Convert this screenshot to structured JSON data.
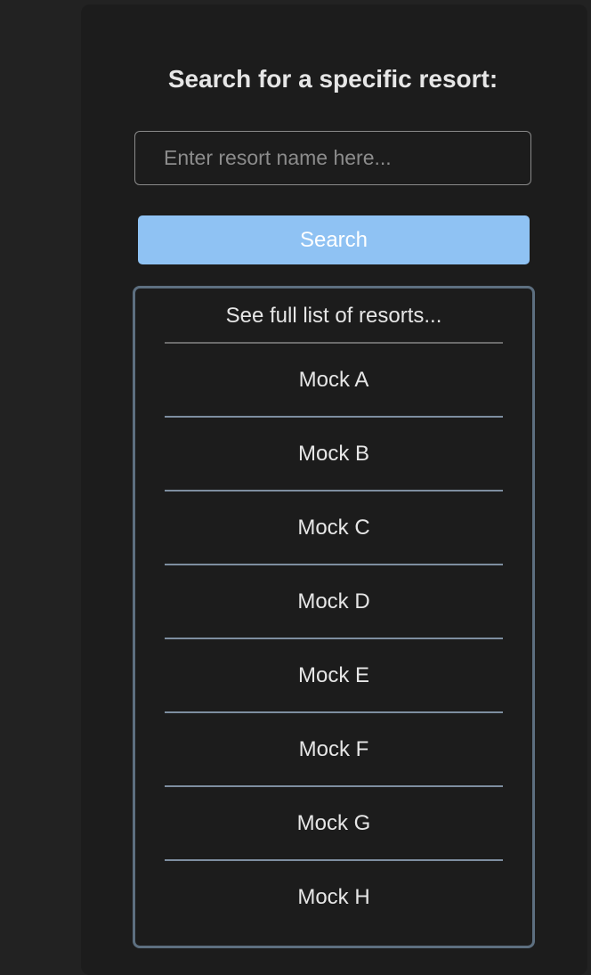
{
  "search": {
    "title": "Search for a specific resort:",
    "placeholder": "Enter resort name here...",
    "value": "",
    "button_label": "Search"
  },
  "resort_list": {
    "header": "See full list of resorts...",
    "items": [
      {
        "label": "Mock A"
      },
      {
        "label": "Mock B"
      },
      {
        "label": "Mock C"
      },
      {
        "label": "Mock D"
      },
      {
        "label": "Mock E"
      },
      {
        "label": "Mock F"
      },
      {
        "label": "Mock G"
      },
      {
        "label": "Mock H"
      }
    ]
  },
  "colors": {
    "page_background": "#222222",
    "panel_background": "#1c1c1c",
    "button_background": "#8fc2f3",
    "list_border": "#5d6f80",
    "divider": "#7e8ea0",
    "text": "#e6e6e6"
  }
}
